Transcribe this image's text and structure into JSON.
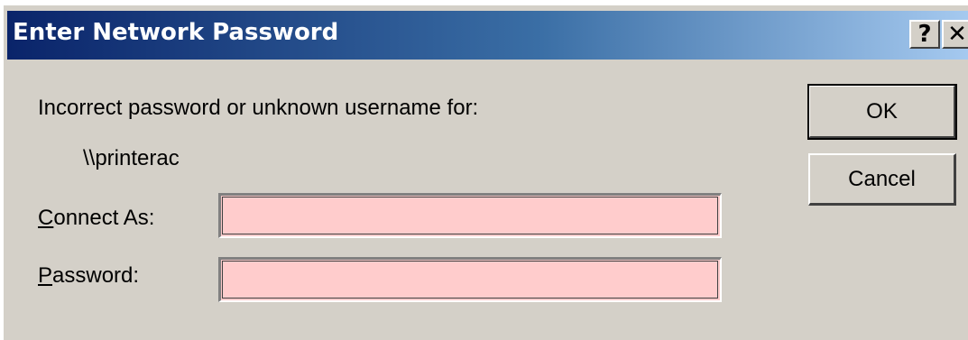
{
  "window": {
    "title": "Enter Network Password",
    "help_label": "?",
    "close_label": "✕"
  },
  "message": {
    "text": "Incorrect password or unknown username for:",
    "target": "\\\\printerac"
  },
  "form": {
    "connect_as": {
      "label_mnemonic": "C",
      "label_rest": "onnect As:",
      "value": ""
    },
    "password": {
      "label_mnemonic": "P",
      "label_rest": "assword:",
      "value": ""
    }
  },
  "buttons": {
    "ok_label": "OK",
    "cancel_label": "Cancel"
  },
  "colors": {
    "titlebar_start": "#0a246a",
    "titlebar_end": "#a6caf0",
    "dialog_face": "#d4d0c8",
    "field_background": "#ffcccc"
  }
}
